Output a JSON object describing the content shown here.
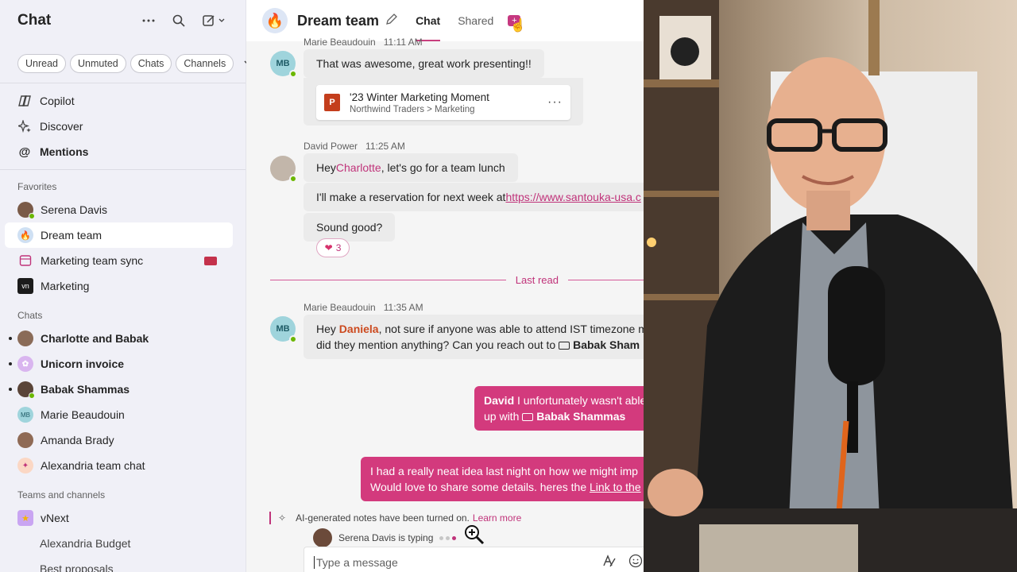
{
  "sidebar": {
    "title": "Chat",
    "filters": [
      "Unread",
      "Unmuted",
      "Chats",
      "Channels"
    ],
    "nav": [
      {
        "label": "Copilot",
        "icon": "copilot-icon"
      },
      {
        "label": "Discover",
        "icon": "sparkle-icon"
      },
      {
        "label": "Mentions",
        "icon": "at-icon"
      }
    ],
    "favorites_label": "Favorites",
    "favorites": [
      {
        "label": "Serena Davis"
      },
      {
        "label": "Dream team"
      },
      {
        "label": "Marketing team sync"
      },
      {
        "label": "Marketing"
      }
    ],
    "chats_label": "Chats",
    "chats": [
      {
        "label": "Charlotte and Babak"
      },
      {
        "label": "Unicorn invoice"
      },
      {
        "label": "Babak Shammas"
      },
      {
        "label": "Marie Beaudouin",
        "initials": "MB"
      },
      {
        "label": "Amanda Brady"
      },
      {
        "label": "Alexandria team chat"
      }
    ],
    "teams_label": "Teams and channels",
    "teams": [
      {
        "label": "vNext"
      },
      {
        "label": "Alexandria Budget"
      },
      {
        "label": "Best proposals"
      }
    ]
  },
  "header": {
    "title": "Dream team",
    "tabs": [
      "Chat",
      "Shared"
    ],
    "add_tab": "+"
  },
  "messages": {
    "m1_author": "Marie Beaudouin",
    "m1_time": "11:11 AM",
    "m1_avatar": "MB",
    "m1_text": "That was awesome, great work presenting!!",
    "file_title": "'23 Winter Marketing Moment",
    "file_path": "Northwind Traders > Marketing",
    "file_icon": "P",
    "file_more": "···",
    "m2_author": "David Power",
    "m2_time": "11:25 AM",
    "m2_text_pre": "Hey ",
    "m2_mention": "Charlotte",
    "m2_text_post": ", let's go for a team lunch",
    "m3_text": "I'll make a reservation for next week at ",
    "m3_link": "https://www.santouka-usa.c",
    "m4_text": "Sound good?",
    "reaction_emoji": "❤",
    "reaction_count": "3",
    "last_read": "Last read",
    "m5_author": "Marie Beaudouin",
    "m5_time": "11:35 AM",
    "m5_avatar": "MB",
    "m5_pre": "Hey ",
    "m5_mention": "Daniela",
    "m5_post": ", not sure if anyone was able to attend IST timezone m",
    "m5_line2": "did they mention anything? Can you reach out to ",
    "m5_contact": "Babak Sham",
    "out1_name": "David",
    "out1_text": " I unfortunately wasn't able",
    "out1_line2_pre": "up with ",
    "out1_contact": "Babak Shammas",
    "out2_line1": "I had a really neat idea last night on how we might imp",
    "out2_line2_pre": "Would love to share some details. heres the ",
    "out2_link": "Link to the"
  },
  "ai_note": {
    "text": "AI-generated notes have been turned on.",
    "link": "Learn more"
  },
  "typing": {
    "text": "Serena Davis is typing"
  },
  "composer": {
    "placeholder": "Type a message"
  },
  "colors": {
    "accent": "#c0337a",
    "outgoing_bubble": "#d33a7d",
    "presence": "#6bb700"
  }
}
